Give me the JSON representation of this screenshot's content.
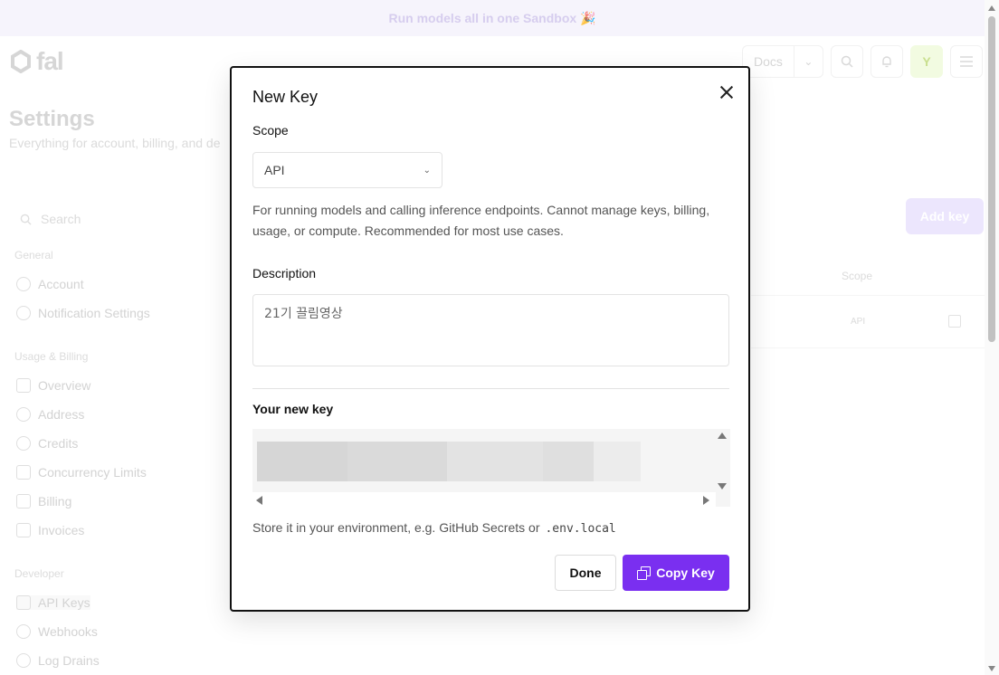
{
  "banner": {
    "text": "Run models all in one Sandbox 🎉"
  },
  "brand": {
    "logo_text": "fal"
  },
  "topbar": {
    "docs_label": "Docs",
    "avatar_initial": "Y"
  },
  "page": {
    "title": "Settings",
    "subtitle": "Everything for account, billing, and de"
  },
  "sidebar": {
    "search_placeholder": "Search",
    "sections": [
      {
        "title": "General",
        "items": [
          "Account",
          "Notification Settings"
        ]
      },
      {
        "title": "Usage & Billing",
        "items": [
          "Overview",
          "Address",
          "Credits",
          "Concurrency Limits",
          "Billing",
          "Invoices"
        ]
      },
      {
        "title": "Developer",
        "items": [
          "API Keys",
          "Webhooks",
          "Log Drains"
        ]
      }
    ]
  },
  "keys_panel": {
    "add_key_label": "Add key",
    "scope_header": "Scope",
    "row_scope": "API"
  },
  "modal": {
    "title": "New Key",
    "scope_label": "Scope",
    "scope_value": "API",
    "scope_help": "For running models and calling inference endpoints. Cannot manage keys, billing, usage, or compute. Recommended for most use cases.",
    "description_label": "Description",
    "description_value": "21기 끌림영상",
    "new_key_label": "Your new key",
    "store_text": "Store it in your environment, e.g. GitHub Secrets or",
    "store_code": ".env.local",
    "done_label": "Done",
    "copy_label": "Copy Key"
  },
  "colors": {
    "accent": "#7a2ff0",
    "banner_text": "#c9bde9"
  }
}
